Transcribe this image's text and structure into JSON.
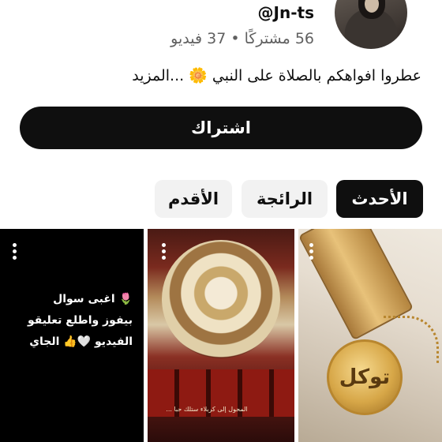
{
  "channel": {
    "handle": "@Jn-ts",
    "stats": "56 مشتركًا • 37 فيديو",
    "description": "عطروا افواهكم بالصلاة على النبي 🌼 ...المزيد"
  },
  "actions": {
    "subscribe_label": "اشتراك"
  },
  "filters": {
    "newest": "الأحدث",
    "popular": "الرائجة",
    "oldest": "الأقدم",
    "selected": "الأحدث"
  },
  "shorts": [
    {
      "overlay_text": "🌷 اغبى سوال بيفوز واطلع تعليقو الفيديو 🤍👍 الجاي"
    },
    {
      "overlay_text": "المحول إلى كربلاء ستلك حبا ..."
    },
    {
      "overlay_text": "توكل"
    }
  ],
  "colors": {
    "primary": "#0f0f0f",
    "chip_background": "#f2f2f2",
    "secondary_text": "#606060"
  }
}
